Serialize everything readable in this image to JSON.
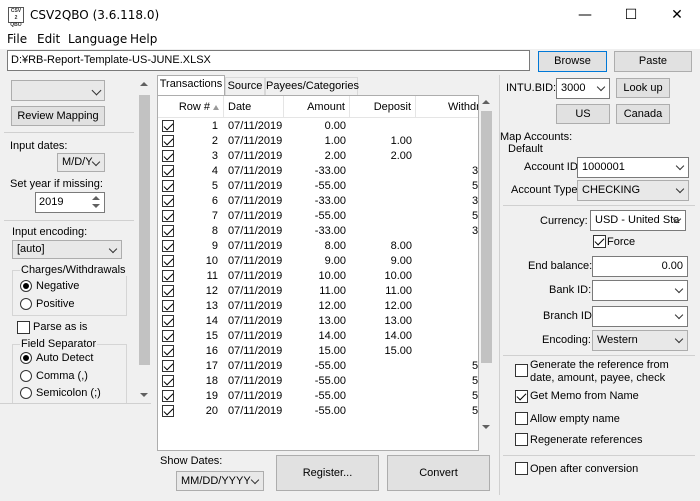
{
  "window": {
    "icon_text": "CSV 2 QBO",
    "title": "CSV2QBO (3.6.118.0)",
    "minimize": "—",
    "maximize": "☐",
    "close": "✕"
  },
  "menu": [
    "File",
    "Edit",
    "Language",
    "Help"
  ],
  "file_path": "D:¥RB-Report-Template-US-JUNE.XLSX",
  "buttons": {
    "browse": "Browse",
    "paste": "Paste",
    "review_mapping": "Review Mapping",
    "register": "Register...",
    "convert": "Convert",
    "look_up": "Look up",
    "us": "US",
    "canada": "Canada"
  },
  "left": {
    "input_dates_label": "Input dates:",
    "date_format": "M/D/Y",
    "set_year_label": "Set year if missing:",
    "year": "2019",
    "input_encoding_label": "Input encoding:",
    "input_encoding": "[auto]",
    "charges_group": "Charges/Withdrawals",
    "negative": "Negative",
    "positive": "Positive",
    "parse_as_is": "Parse as is",
    "field_separator_group": "Field Separator",
    "auto_detect": "Auto Detect",
    "comma": "Comma (,)",
    "semicolon": "Semicolon (;)"
  },
  "tabs": [
    "Transactions",
    "Source",
    "Payees/Categories"
  ],
  "grid": {
    "columns": [
      "Row #",
      "Date",
      "Amount",
      "Deposit",
      "Withdra"
    ],
    "rows": [
      {
        "n": "1",
        "date": "07/11/2019",
        "amount": "0.00",
        "deposit": "",
        "w": ""
      },
      {
        "n": "2",
        "date": "07/11/2019",
        "amount": "1.00",
        "deposit": "1.00",
        "w": ""
      },
      {
        "n": "3",
        "date": "07/11/2019",
        "amount": "2.00",
        "deposit": "2.00",
        "w": ""
      },
      {
        "n": "4",
        "date": "07/11/2019",
        "amount": "-33.00",
        "deposit": "",
        "w": "3"
      },
      {
        "n": "5",
        "date": "07/11/2019",
        "amount": "-55.00",
        "deposit": "",
        "w": "5"
      },
      {
        "n": "6",
        "date": "07/11/2019",
        "amount": "-33.00",
        "deposit": "",
        "w": "3"
      },
      {
        "n": "7",
        "date": "07/11/2019",
        "amount": "-55.00",
        "deposit": "",
        "w": "5"
      },
      {
        "n": "8",
        "date": "07/11/2019",
        "amount": "-33.00",
        "deposit": "",
        "w": "3"
      },
      {
        "n": "9",
        "date": "07/11/2019",
        "amount": "8.00",
        "deposit": "8.00",
        "w": ""
      },
      {
        "n": "10",
        "date": "07/11/2019",
        "amount": "9.00",
        "deposit": "9.00",
        "w": ""
      },
      {
        "n": "11",
        "date": "07/11/2019",
        "amount": "10.00",
        "deposit": "10.00",
        "w": ""
      },
      {
        "n": "12",
        "date": "07/11/2019",
        "amount": "11.00",
        "deposit": "11.00",
        "w": ""
      },
      {
        "n": "13",
        "date": "07/11/2019",
        "amount": "12.00",
        "deposit": "12.00",
        "w": ""
      },
      {
        "n": "14",
        "date": "07/11/2019",
        "amount": "13.00",
        "deposit": "13.00",
        "w": ""
      },
      {
        "n": "15",
        "date": "07/11/2019",
        "amount": "14.00",
        "deposit": "14.00",
        "w": ""
      },
      {
        "n": "16",
        "date": "07/11/2019",
        "amount": "15.00",
        "deposit": "15.00",
        "w": ""
      },
      {
        "n": "17",
        "date": "07/11/2019",
        "amount": "-55.00",
        "deposit": "",
        "w": "5"
      },
      {
        "n": "18",
        "date": "07/11/2019",
        "amount": "-55.00",
        "deposit": "",
        "w": "5"
      },
      {
        "n": "19",
        "date": "07/11/2019",
        "amount": "-55.00",
        "deposit": "",
        "w": "5"
      },
      {
        "n": "20",
        "date": "07/11/2019",
        "amount": "-55.00",
        "deposit": "",
        "w": "5"
      }
    ]
  },
  "bottom": {
    "show_dates_label": "Show Dates:",
    "show_dates": "MM/DD/YYYY"
  },
  "right": {
    "intu_bid_label": "INTU.BID:",
    "intu_bid": "3000",
    "map_accounts_label": "Map Accounts:",
    "default_label": "Default",
    "account_id_label": "Account ID:",
    "account_id": "1000001",
    "account_type_label": "Account Type:",
    "account_type": "CHECKING",
    "currency_label": "Currency:",
    "currency": "USD - United Sta",
    "force": "Force",
    "end_balance_label": "End balance:",
    "end_balance": "0.00",
    "bank_id_label": "Bank ID:",
    "branch_id_label": "Branch ID",
    "encoding_label": "Encoding:",
    "encoding": "Western",
    "gen_ref": "Generate the reference from date, amount, payee, check",
    "get_memo": "Get Memo from Name",
    "allow_empty": "Allow empty name",
    "regen_refs": "Regenerate references",
    "open_after": "Open after conversion"
  }
}
